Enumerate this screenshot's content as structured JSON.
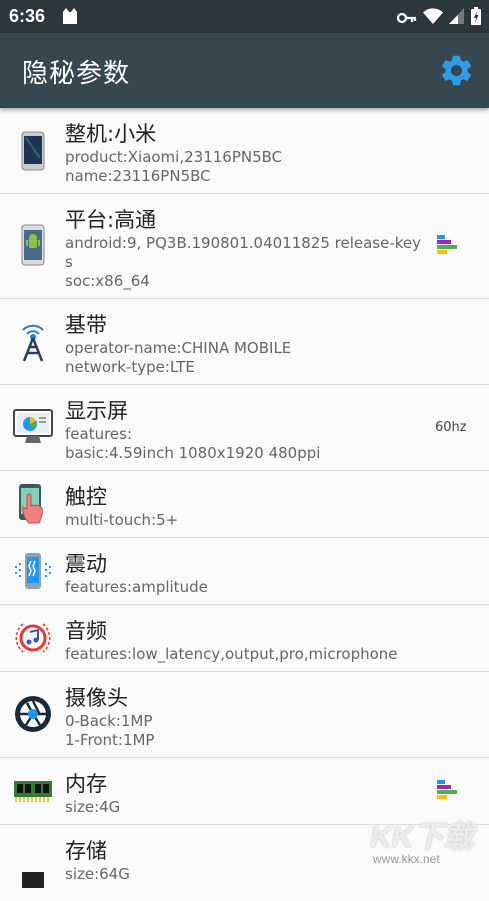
{
  "status_bar": {
    "time": "6:36",
    "icons": [
      "cat-icon",
      "key-icon",
      "wifi-icon",
      "signal-icon",
      "battery-icon"
    ]
  },
  "app_bar": {
    "title": "隐秘参数",
    "settings_icon": "gear-icon",
    "accent": "#37474f"
  },
  "items": [
    {
      "name": "整机:小米",
      "lines": [
        "product:Xiaomi,23116PN5BC",
        "name:23116PN5BC"
      ],
      "icon": "phone-icon"
    },
    {
      "name": "平台:高通",
      "lines": [
        "android:9, PQ3B.190801.04011825 release-key",
        "s",
        "soc:x86_64"
      ],
      "icon": "android-phone-icon",
      "side_icon": "bar-chart-icon"
    },
    {
      "name": "基带",
      "lines": [
        "operator-name:CHINA MOBILE",
        "network-type:LTE"
      ],
      "icon": "antenna-icon"
    },
    {
      "name": "显示屏",
      "lines": [
        "features:",
        "basic:4.59inch 1080x1920 480ppi"
      ],
      "icon": "monitor-icon",
      "side_text": "60hz"
    },
    {
      "name": "触控",
      "lines": [
        "multi-touch:5+"
      ],
      "icon": "touch-hand-icon"
    },
    {
      "name": "震动",
      "lines": [
        "features:amplitude"
      ],
      "icon": "vibration-icon"
    },
    {
      "name": "音频",
      "lines": [
        "features:low_latency,output,pro,microphone"
      ],
      "icon": "music-icon"
    },
    {
      "name": "摄像头",
      "lines": [
        "0-Back:1MP",
        "1-Front:1MP"
      ],
      "icon": "camera-aperture-icon"
    },
    {
      "name": "内存",
      "lines": [
        "size:4G"
      ],
      "icon": "ram-chip-icon",
      "side_icon": "bar-chart-icon"
    },
    {
      "name": "存储",
      "lines": [
        "size:64G"
      ],
      "icon": "storage-chip-icon"
    }
  ],
  "watermark": {
    "big": "KK下载",
    "small": "www.kkx.net"
  }
}
